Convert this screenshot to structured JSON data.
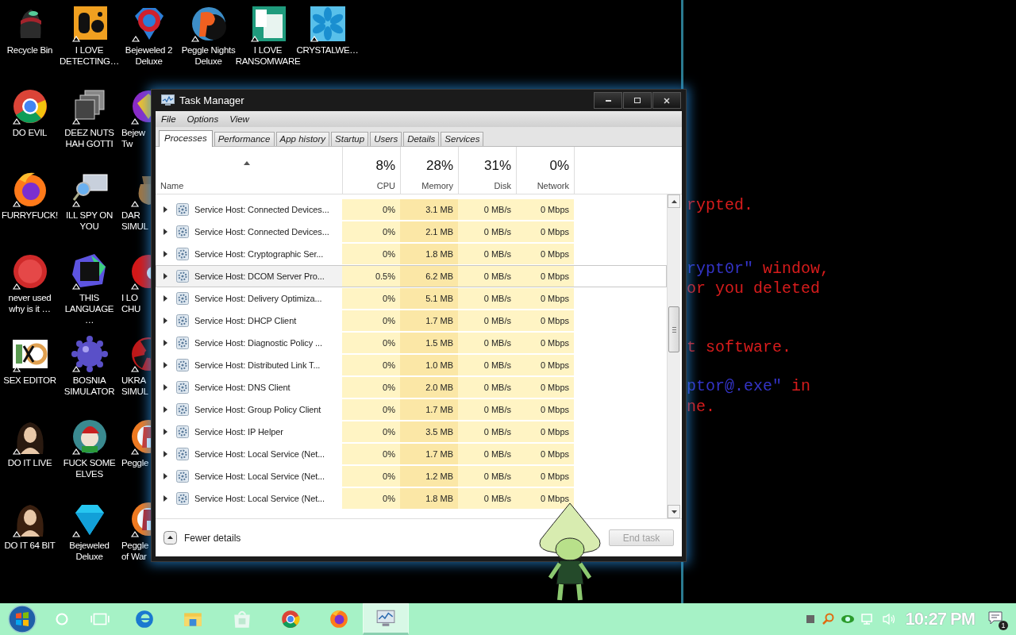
{
  "desktop": {
    "icons": [
      {
        "label": "Recycle Bin"
      },
      {
        "label": "I LOVE\nDETECTING…"
      },
      {
        "label": "Bejeweled 2\nDeluxe"
      },
      {
        "label": "Peggle Nights\nDeluxe"
      },
      {
        "label": "I LOVE\nRANSOMWARE"
      },
      {
        "label": "CRYSTALWE…"
      },
      {
        "label": "DO EVIL"
      },
      {
        "label": "DEEZ NUTS\nHAH GOTTI"
      },
      {
        "label": "Bejew\nTw"
      },
      {
        "label": "FURRYFUCK!"
      },
      {
        "label": "ILL SPY ON\nYOU"
      },
      {
        "label": "DAR\nSIMUL"
      },
      {
        "label": "never used\nwhy is it …"
      },
      {
        "label": "THIS\nLANGUAGE …"
      },
      {
        "label": "I LO\nCHU"
      },
      {
        "label": "SEX EDITOR"
      },
      {
        "label": "BOSNIA\nSIMULATOR"
      },
      {
        "label": "UKRA\nSIMUL"
      },
      {
        "label": "DO IT LIVE"
      },
      {
        "label": "FUCK SOME\nELVES"
      },
      {
        "label": "Peggle"
      },
      {
        "label": "DO IT 64 BIT"
      },
      {
        "label": "Bejeweled\nDeluxe"
      },
      {
        "label": "Peggle\nof War"
      }
    ]
  },
  "background_window": {
    "lines": [
      {
        "segments": [
          {
            "text": "rypted.",
            "kind": "plain"
          }
        ]
      },
      {
        "segments": [
          {
            "text": "rypt0r\"",
            "kind": "accent"
          },
          {
            "text": " window,",
            "kind": "plain"
          }
        ]
      },
      {
        "segments": [
          {
            "text": "or you deleted",
            "kind": "plain"
          }
        ]
      },
      {
        "segments": [
          {
            "text": "t software.",
            "kind": "plain"
          }
        ]
      },
      {
        "segments": [
          {
            "text": "ptor@.exe\"",
            "kind": "accent"
          },
          {
            "text": " in",
            "kind": "plain"
          }
        ]
      },
      {
        "segments": [
          {
            "text": "ne.",
            "kind": "plain"
          }
        ]
      }
    ]
  },
  "task_manager": {
    "title": "Task Manager",
    "menu": [
      "File",
      "Options",
      "View"
    ],
    "tabs": [
      {
        "label": "Processes",
        "selected": true
      },
      {
        "label": "Performance",
        "selected": false
      },
      {
        "label": "App history",
        "selected": false
      },
      {
        "label": "Startup",
        "selected": false
      },
      {
        "label": "Users",
        "selected": false
      },
      {
        "label": "Details",
        "selected": false
      },
      {
        "label": "Services",
        "selected": false
      }
    ],
    "columns": [
      {
        "label": "Name"
      },
      {
        "label": "CPU",
        "usage": "8%"
      },
      {
        "label": "Memory",
        "usage": "28%"
      },
      {
        "label": "Disk",
        "usage": "31%"
      },
      {
        "label": "Network",
        "usage": "0%"
      }
    ],
    "rows": [
      {
        "name": "Service Host: Connected Devices...",
        "cpu": "0%",
        "memory": "3.1 MB",
        "disk": "0 MB/s",
        "network": "0 Mbps",
        "highlighted": false
      },
      {
        "name": "Service Host: Connected Devices...",
        "cpu": "0%",
        "memory": "2.1 MB",
        "disk": "0 MB/s",
        "network": "0 Mbps",
        "highlighted": false
      },
      {
        "name": "Service Host: Cryptographic Ser...",
        "cpu": "0%",
        "memory": "1.8 MB",
        "disk": "0 MB/s",
        "network": "0 Mbps",
        "highlighted": false
      },
      {
        "name": "Service Host: DCOM Server Pro...",
        "cpu": "0.5%",
        "memory": "6.2 MB",
        "disk": "0 MB/s",
        "network": "0 Mbps",
        "highlighted": true
      },
      {
        "name": "Service Host: Delivery Optimiza...",
        "cpu": "0%",
        "memory": "5.1 MB",
        "disk": "0 MB/s",
        "network": "0 Mbps",
        "highlighted": false
      },
      {
        "name": "Service Host: DHCP Client",
        "cpu": "0%",
        "memory": "1.7 MB",
        "disk": "0 MB/s",
        "network": "0 Mbps",
        "highlighted": false
      },
      {
        "name": "Service Host: Diagnostic Policy ...",
        "cpu": "0%",
        "memory": "1.5 MB",
        "disk": "0 MB/s",
        "network": "0 Mbps",
        "highlighted": false
      },
      {
        "name": "Service Host: Distributed Link T...",
        "cpu": "0%",
        "memory": "1.0 MB",
        "disk": "0 MB/s",
        "network": "0 Mbps",
        "highlighted": false
      },
      {
        "name": "Service Host: DNS Client",
        "cpu": "0%",
        "memory": "2.0 MB",
        "disk": "0 MB/s",
        "network": "0 Mbps",
        "highlighted": false
      },
      {
        "name": "Service Host: Group Policy Client",
        "cpu": "0%",
        "memory": "1.7 MB",
        "disk": "0 MB/s",
        "network": "0 Mbps",
        "highlighted": false
      },
      {
        "name": "Service Host: IP Helper",
        "cpu": "0%",
        "memory": "3.5 MB",
        "disk": "0 MB/s",
        "network": "0 Mbps",
        "highlighted": false
      },
      {
        "name": "Service Host: Local Service (Net...",
        "cpu": "0%",
        "memory": "1.7 MB",
        "disk": "0 MB/s",
        "network": "0 Mbps",
        "highlighted": false
      },
      {
        "name": "Service Host: Local Service (Net...",
        "cpu": "0%",
        "memory": "1.2 MB",
        "disk": "0 MB/s",
        "network": "0 Mbps",
        "highlighted": false
      },
      {
        "name": "Service Host: Local Service (Net...",
        "cpu": "0%",
        "memory": "1.8 MB",
        "disk": "0 MB/s",
        "network": "0 Mbps",
        "highlighted": false
      }
    ],
    "footer": {
      "toggle": "Fewer details",
      "end_task": {
        "label": "End task",
        "disabled": true
      }
    }
  },
  "taskbar": {
    "apps": [
      {
        "active": false
      },
      {
        "active": false
      },
      {
        "active": false
      },
      {
        "active": false
      },
      {
        "active": false
      },
      {
        "active": true
      }
    ],
    "clock": "10:27 PM",
    "notifications": "1"
  }
}
